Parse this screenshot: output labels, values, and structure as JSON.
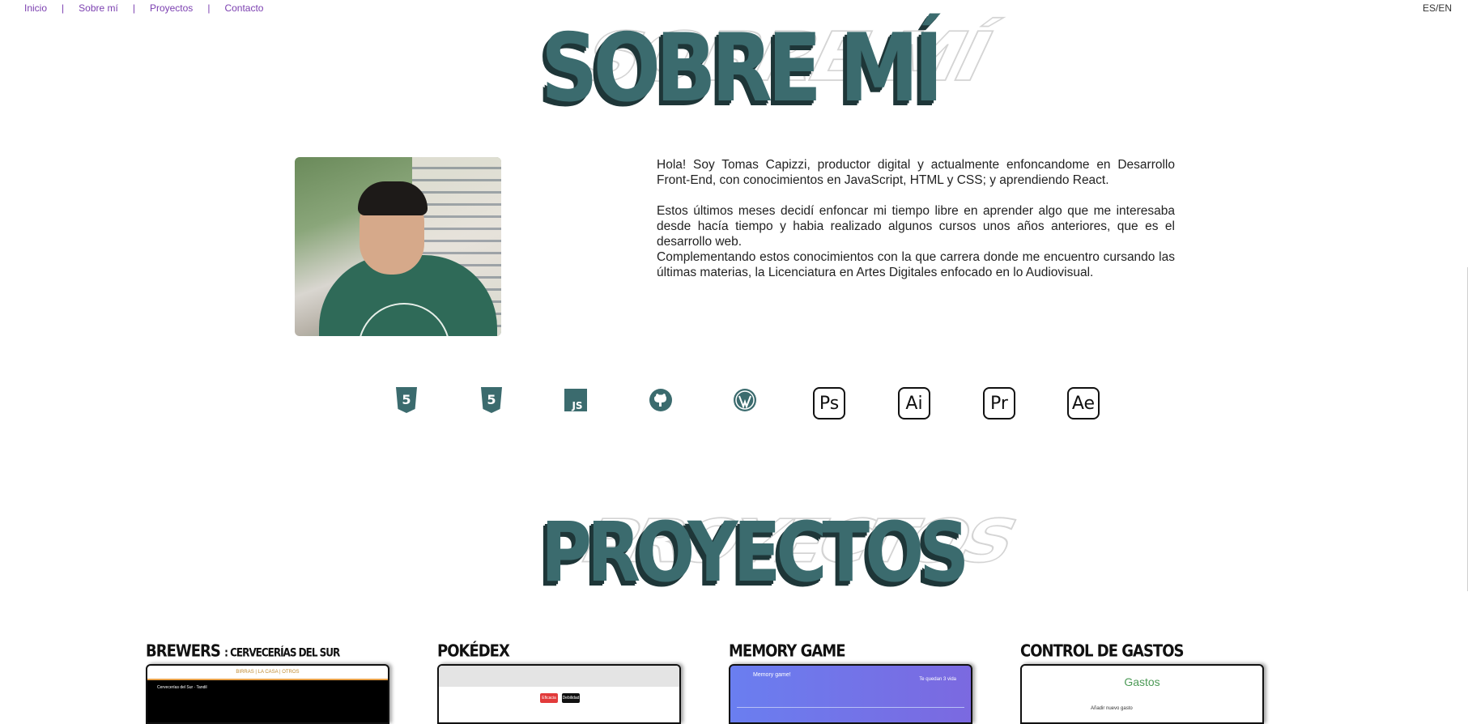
{
  "nav": {
    "items": [
      "Inicio",
      "Sobre mí",
      "Proyectos",
      "Contacto"
    ],
    "separator": "|",
    "lang": "ES/EN"
  },
  "about": {
    "title": "SOBRE MÍ",
    "paragraph1": "Hola! Soy Tomas Capizzi, productor digital y actualmente enfoncandome en Desarrollo Front-End, con conocimientos en JavaScript, HTML y CSS; y aprendiendo React.",
    "paragraph2": "Estos últimos meses decidí enfoncar mi tiempo libre en aprender algo que me interesaba desde hacía tiempo y habia realizado algunos cursos unos años anteriores, que es el desarrollo web.",
    "paragraph3": "Complementando estos conocimientos con la que carrera donde me encuentro cursando las últimas materias, la Licenciatura en Artes Digitales enfocado en lo Audiovisual."
  },
  "skills": [
    {
      "name": "html5-icon",
      "label": "5"
    },
    {
      "name": "css3-icon",
      "label": "5"
    },
    {
      "name": "javascript-icon",
      "label": "JS"
    },
    {
      "name": "github-icon",
      "label": ""
    },
    {
      "name": "wordpress-icon",
      "label": ""
    },
    {
      "name": "photoshop-icon",
      "label": "Ps"
    },
    {
      "name": "illustrator-icon",
      "label": "Ai"
    },
    {
      "name": "premiere-icon",
      "label": "Pr"
    },
    {
      "name": "after-effects-icon",
      "label": "Ae"
    }
  ],
  "projects": {
    "title": "PROYECTOS",
    "items": [
      {
        "title": "BREWERS",
        "subtitle": ": CERVECERÍAS DEL SUR"
      },
      {
        "title": "POKÉDEX",
        "subtitle": ""
      },
      {
        "title": "MEMORY GAME",
        "subtitle": ""
      },
      {
        "title": "CONTROL DE GASTOS",
        "subtitle": ""
      }
    ],
    "thumbs": {
      "brewers_nav": "BIRRAS  |  LA CASA  |  OTROS",
      "brewers_label": "Cervecerías del Sur · Tandil",
      "pokedex_btn1": "Eficacia",
      "pokedex_btn2": "Debilidad",
      "memory_title": "Memory game!",
      "memory_right": "Te quedan 3 vida",
      "gastos_title": "Gastos",
      "gastos_sub": "Añadir nuevo gasto"
    }
  },
  "colors": {
    "accent": "#3b6b6e",
    "nav": "#7b3fb0",
    "shadow": "#1e3638"
  }
}
